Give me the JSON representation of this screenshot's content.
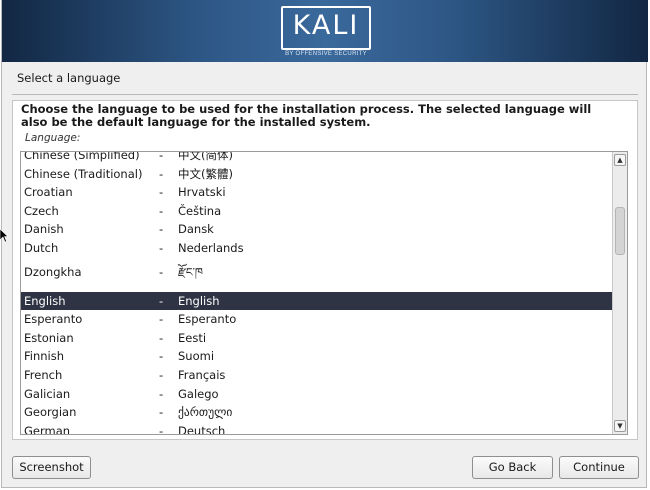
{
  "logo": {
    "word": "KALI",
    "subtitle": "BY OFFENSIVE SECURITY"
  },
  "step_title": "Select a language",
  "description": "Choose the language to be used for the installation process. The selected language will also be the default language for the installed system.",
  "language_label": "Language:",
  "languages": [
    {
      "name": "Chinese (Simplified)",
      "native": "中文(简体)"
    },
    {
      "name": "Chinese (Traditional)",
      "native": "中文(繁體)"
    },
    {
      "name": "Croatian",
      "native": "Hrvatski"
    },
    {
      "name": "Czech",
      "native": "Čeština"
    },
    {
      "name": "Danish",
      "native": "Dansk"
    },
    {
      "name": "Dutch",
      "native": "Nederlands"
    },
    {
      "name": "Dzongkha",
      "native": "རྫོང་ཁ"
    },
    {
      "name": "English",
      "native": "English"
    },
    {
      "name": "Esperanto",
      "native": "Esperanto"
    },
    {
      "name": "Estonian",
      "native": "Eesti"
    },
    {
      "name": "Finnish",
      "native": "Suomi"
    },
    {
      "name": "French",
      "native": "Français"
    },
    {
      "name": "Galician",
      "native": "Galego"
    },
    {
      "name": "Georgian",
      "native": "ქართული"
    },
    {
      "name": "German",
      "native": "Deutsch"
    }
  ],
  "separator": "-",
  "selected_language": "English",
  "buttons": {
    "screenshot": "Screenshot",
    "go_back": "Go Back",
    "continue": "Continue"
  },
  "icons": {
    "scroll_up": "chevron-up-icon",
    "scroll_down": "chevron-down-icon",
    "cursor": "mouse-pointer-icon"
  },
  "colors": {
    "banner": "#2d5684",
    "selection": "#2e3443",
    "background": "#efefef"
  }
}
